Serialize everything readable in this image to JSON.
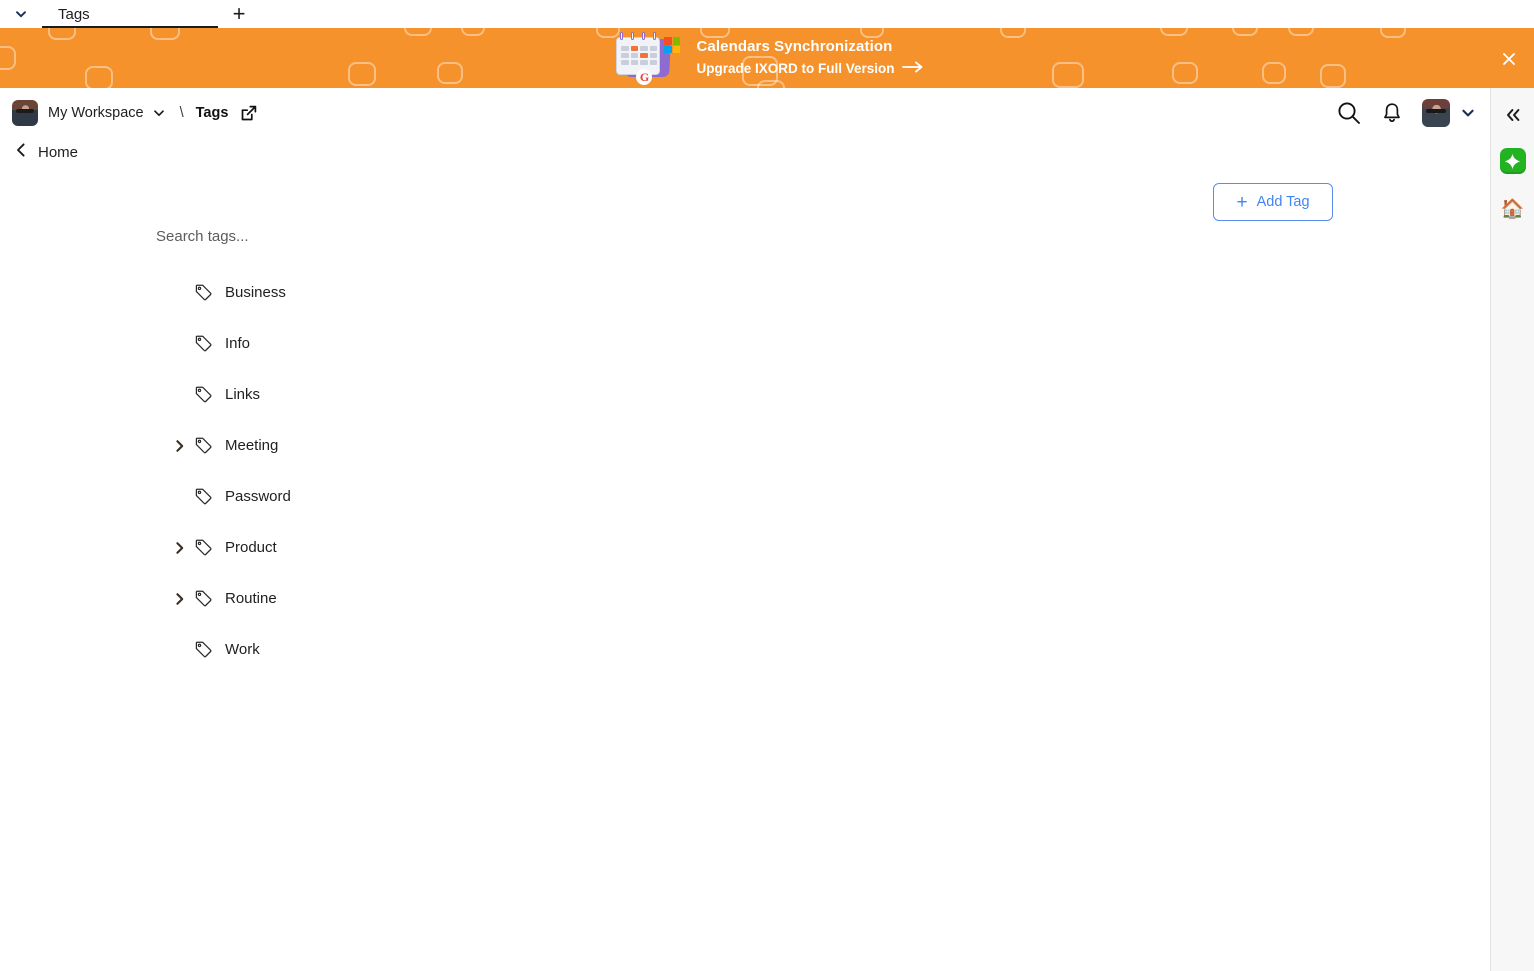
{
  "browser": {
    "tab_dropdown_icon": "chevron-down-icon",
    "tabs": [
      {
        "label": "Tags",
        "active": true
      }
    ],
    "new_tab_label": "+"
  },
  "promo": {
    "icon": "calendar-sync-illustration",
    "title": "Calendars Synchronization",
    "subtitle": "Upgrade IXORD to Full Version",
    "arrow": "→",
    "close_icon": "close-icon",
    "background_color": "#F5922B",
    "text_color": "#FFFFFF"
  },
  "header": {
    "workspace_name": "My Workspace",
    "workspace_chevron_icon": "chevron-down-icon",
    "separator": "\\",
    "page_title": "Tags",
    "open_external_icon": "external-link-icon",
    "search_icon": "search-icon",
    "notifications_icon": "bell-icon",
    "account_avatar": "user-avatar",
    "account_chevron_icon": "chevron-down-icon"
  },
  "breadcrumb": {
    "back_icon": "chevron-left-icon",
    "label": "Home"
  },
  "toolbar": {
    "add_tag_label": "Add Tag",
    "add_tag_plus": "+",
    "add_tag_color": "#4285F4"
  },
  "tags_panel": {
    "search_placeholder": "Search tags...",
    "search_value": "",
    "items": [
      {
        "label": "Business",
        "expandable": false
      },
      {
        "label": "Info",
        "expandable": false
      },
      {
        "label": "Links",
        "expandable": false
      },
      {
        "label": "Meeting",
        "expandable": true
      },
      {
        "label": "Password",
        "expandable": false
      },
      {
        "label": "Product",
        "expandable": true
      },
      {
        "label": "Routine",
        "expandable": true
      },
      {
        "label": "Work",
        "expandable": false
      }
    ]
  },
  "right_rail": {
    "collapse_icon": "chevrons-left-icon",
    "ai_icon": "sparkle-icon",
    "ai_color": "#22B322",
    "home_icon": "house-icon",
    "home_glyph": "🏠"
  }
}
